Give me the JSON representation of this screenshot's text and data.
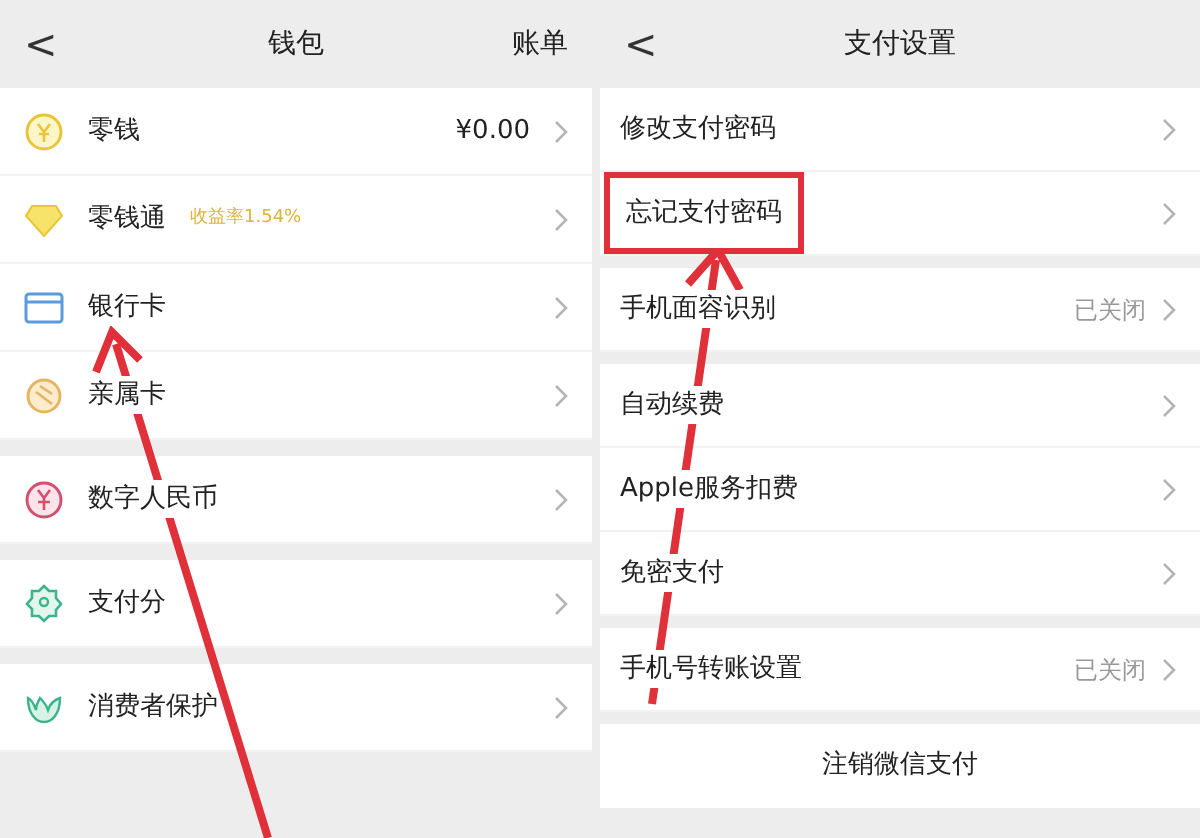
{
  "wallet": {
    "back": "<",
    "title": "钱包",
    "action": "账单",
    "groups": [
      [
        {
          "label": "零钱",
          "value": "¥0.00"
        },
        {
          "label": "零钱通",
          "badge": "收益率1.54%"
        },
        {
          "label": "银行卡"
        },
        {
          "label": "亲属卡"
        }
      ],
      [
        {
          "label": "数字人民币"
        }
      ],
      [
        {
          "label": "支付分"
        }
      ],
      [
        {
          "label": "消费者保护"
        }
      ]
    ]
  },
  "pay_settings": {
    "back": "<",
    "title": "支付设置",
    "groups": [
      [
        {
          "label": "修改支付密码",
          "highlighted": false
        },
        {
          "label": "忘记支付密码",
          "highlighted": true
        }
      ],
      [
        {
          "label": "手机面容识别",
          "value": "已关闭",
          "highlighted": false
        }
      ],
      [
        {
          "label": "自动续费",
          "highlighted": false
        },
        {
          "label": "Apple服务扣费",
          "highlighted": false
        },
        {
          "label": "免密支付",
          "highlighted": false
        }
      ],
      [
        {
          "label": "手机号转账设置",
          "value": "已关闭",
          "highlighted": false
        }
      ]
    ],
    "footer_button": "注销微信支付"
  }
}
